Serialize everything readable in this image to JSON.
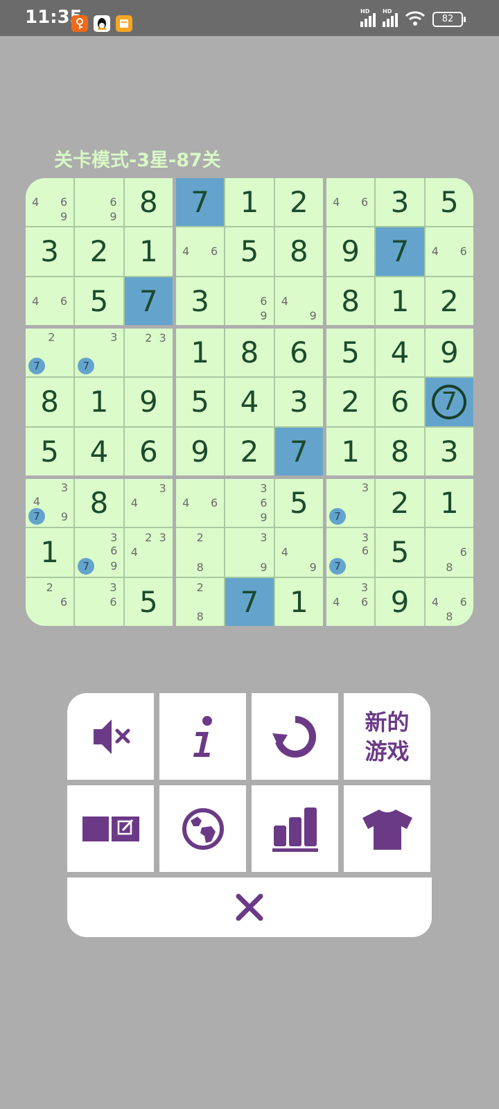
{
  "status_bar": {
    "time": "11:35",
    "battery": "82",
    "signal_label": "HD"
  },
  "level_title": "关卡模式-3星-87关",
  "colors": {
    "cell": "#dbfcca",
    "highlight": "#64a4cc",
    "digit": "#1c4a2c",
    "note": "#6a6a6a",
    "accent": "#6b3a87",
    "background": "#adadad"
  },
  "board": {
    "highlighted_digit": "7",
    "selected": [
      4,
      8
    ],
    "rows": [
      [
        {
          "n": "469"
        },
        {
          "n": "69"
        },
        {
          "v": "8"
        },
        {
          "v": "7"
        },
        {
          "v": "1"
        },
        {
          "v": "2"
        },
        {
          "n": "46"
        },
        {
          "v": "3"
        },
        {
          "v": "5"
        }
      ],
      [
        {
          "v": "3"
        },
        {
          "v": "2"
        },
        {
          "v": "1"
        },
        {
          "n": "46"
        },
        {
          "v": "5"
        },
        {
          "v": "8"
        },
        {
          "v": "9"
        },
        {
          "v": "7"
        },
        {
          "n": "46"
        }
      ],
      [
        {
          "n": "46"
        },
        {
          "v": "5"
        },
        {
          "v": "7"
        },
        {
          "v": "3"
        },
        {
          "n": "69"
        },
        {
          "n": "49"
        },
        {
          "v": "8"
        },
        {
          "v": "1"
        },
        {
          "v": "2"
        }
      ],
      [
        {
          "n": "27"
        },
        {
          "n": "37"
        },
        {
          "n": "23"
        },
        {
          "v": "1"
        },
        {
          "v": "8"
        },
        {
          "v": "6"
        },
        {
          "v": "5"
        },
        {
          "v": "4"
        },
        {
          "v": "9"
        }
      ],
      [
        {
          "v": "8"
        },
        {
          "v": "1"
        },
        {
          "v": "9"
        },
        {
          "v": "5"
        },
        {
          "v": "4"
        },
        {
          "v": "3"
        },
        {
          "v": "2"
        },
        {
          "v": "6"
        },
        {
          "v": "7"
        }
      ],
      [
        {
          "v": "5"
        },
        {
          "v": "4"
        },
        {
          "v": "6"
        },
        {
          "v": "9"
        },
        {
          "v": "2"
        },
        {
          "v": "7"
        },
        {
          "v": "1"
        },
        {
          "v": "8"
        },
        {
          "v": "3"
        }
      ],
      [
        {
          "n": "3479"
        },
        {
          "v": "8"
        },
        {
          "n": "34"
        },
        {
          "n": "46"
        },
        {
          "n": "369"
        },
        {
          "v": "5"
        },
        {
          "n": "37"
        },
        {
          "v": "2"
        },
        {
          "v": "1"
        }
      ],
      [
        {
          "v": "1"
        },
        {
          "n": "3679"
        },
        {
          "n": "234"
        },
        {
          "n": "28"
        },
        {
          "n": "39"
        },
        {
          "n": "49"
        },
        {
          "n": "367"
        },
        {
          "v": "5"
        },
        {
          "n": "68"
        }
      ],
      [
        {
          "n": "26"
        },
        {
          "n": "36"
        },
        {
          "v": "5"
        },
        {
          "n": "28"
        },
        {
          "v": "7"
        },
        {
          "v": "1"
        },
        {
          "n": "346"
        },
        {
          "v": "9"
        },
        {
          "n": "468"
        }
      ]
    ]
  },
  "menu": {
    "buttons": [
      {
        "name": "sound-off",
        "icon": "speaker-muted-icon"
      },
      {
        "name": "info",
        "icon": "info-icon"
      },
      {
        "name": "restart",
        "icon": "refresh-icon"
      },
      {
        "name": "new-game",
        "label": "新的游戏"
      },
      {
        "name": "notes",
        "icon": "notes-toggle-icon"
      },
      {
        "name": "globe",
        "icon": "globe-icon"
      },
      {
        "name": "stats",
        "icon": "bar-chart-icon"
      },
      {
        "name": "theme",
        "icon": "tshirt-icon"
      }
    ],
    "close_icon": "close-icon"
  }
}
